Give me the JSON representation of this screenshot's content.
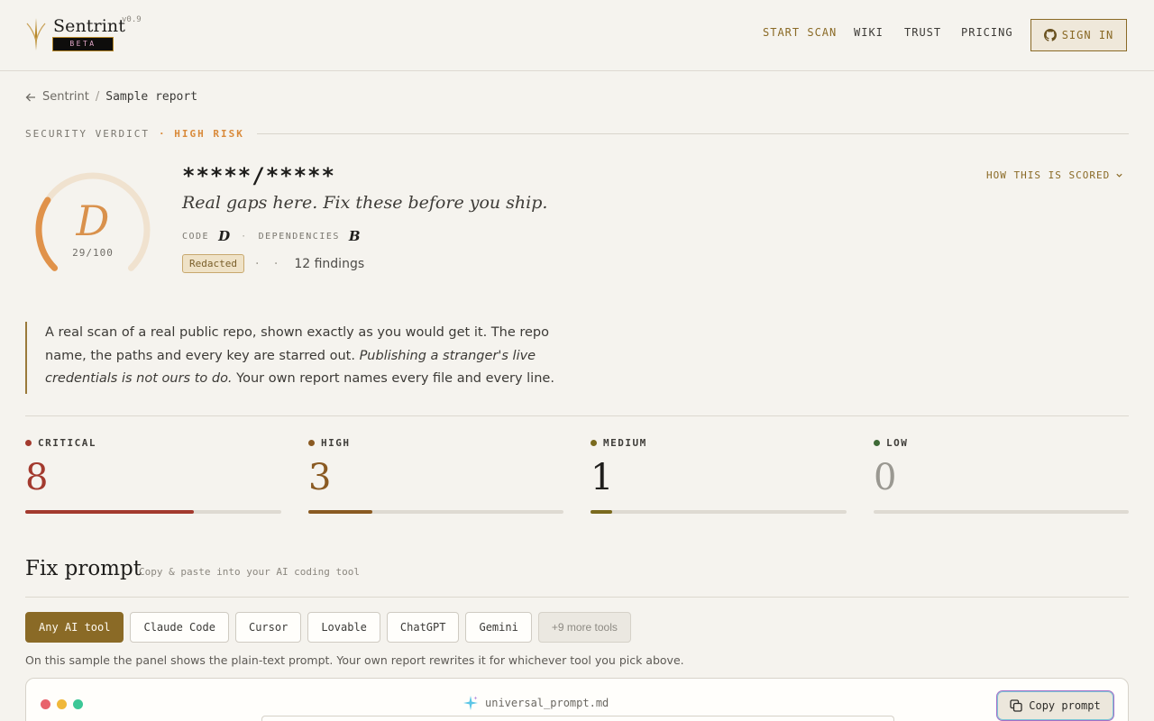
{
  "brand": {
    "name": "Sentrint",
    "version": "v0.9",
    "beta": "BETA"
  },
  "nav": {
    "start_scan": "START SCAN",
    "wiki": "WIKI",
    "trust": "TRUST",
    "pricing": "PRICING",
    "sign_in": "SIGN IN"
  },
  "breadcrumb": {
    "parent": "Sentrint",
    "separator": "/",
    "current": "Sample report"
  },
  "verdict": {
    "label": "SECURITY VERDICT",
    "risk": "· HIGH RISK",
    "grade": "D",
    "score_text": "29/100",
    "score": 29
  },
  "repo": {
    "name": "*****/*****",
    "tagline": "Real gaps here. Fix these before you ship.",
    "code_label": "CODE",
    "code_grade": "D",
    "separator": "·",
    "deps_label": "DEPENDENCIES",
    "deps_grade": "B",
    "badge": "Redacted",
    "dots": "· ·",
    "findings": "12 findings",
    "how_scored": "HOW THIS IS SCORED"
  },
  "intro": {
    "part1": "A real scan of a real public repo, shown exactly as you would get it. The repo name, the paths and every key are starred out. ",
    "emphasis": "Publishing a stranger's live credentials is not ours to do.",
    "part2": " Your own report names every file and every line."
  },
  "severity": [
    {
      "label": "CRITICAL",
      "count": "8",
      "color": "#a33a2e",
      "fill": 0.66
    },
    {
      "label": "HIGH",
      "count": "3",
      "color": "#8a5a22",
      "fill": 0.25
    },
    {
      "label": "MEDIUM",
      "count": "1",
      "color": "#7a6a1e",
      "fill": 0.083
    },
    {
      "label": "LOW",
      "count": "0",
      "color": "#3e6a36",
      "fill": 0
    }
  ],
  "fix": {
    "title": "Fix prompt",
    "subtitle": "Copy & paste into your AI coding tool",
    "tabs": [
      "Any AI tool",
      "Claude Code",
      "Cursor",
      "Lovable",
      "ChatGPT",
      "Gemini",
      "+9 more tools"
    ],
    "active_tab": "Any AI tool",
    "note": "On this sample the panel shows the plain-text prompt. Your own report rewrites it for whichever tool you pick above.",
    "file": "universal_prompt.md",
    "copy": "Copy prompt"
  },
  "icons": {
    "back": "arrow-left-icon",
    "github": "github-icon",
    "chevron": "chevron-down-icon",
    "sparkle": "sparkle-icon",
    "copy": "copy-icon"
  }
}
